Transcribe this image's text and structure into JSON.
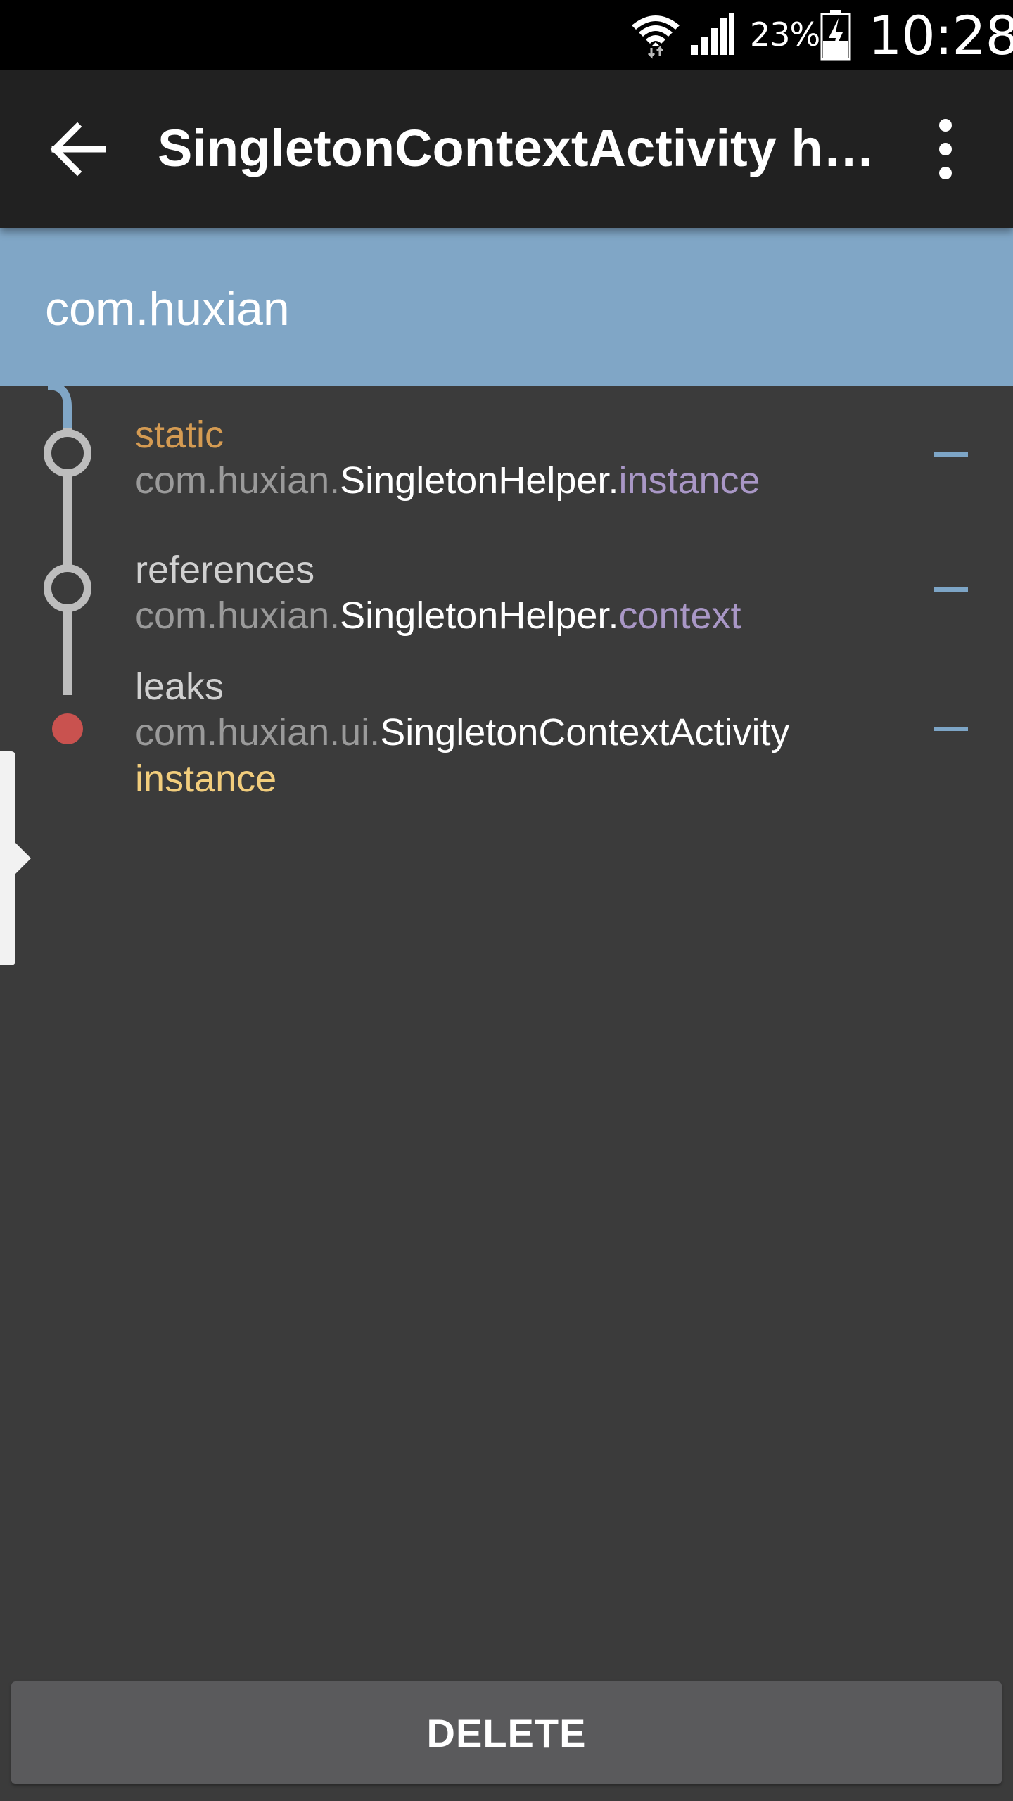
{
  "status_bar": {
    "battery_percent": "23%",
    "time": "10:28",
    "icons": [
      "wifi-icon",
      "cellular-signal-icon",
      "battery-charging-icon"
    ]
  },
  "app_bar": {
    "title": "SingletonContextActivity ha…",
    "back_icon": "arrow-back-icon",
    "menu_icon": "more-vert-icon"
  },
  "header": {
    "package": "com.huxian"
  },
  "trace": [
    {
      "kind": "static",
      "package": "com.huxian.",
      "class": "SingletonHelper",
      "separator": ".",
      "field": "instance"
    },
    {
      "kind": "references",
      "package": "com.huxian.",
      "class": "SingletonHelper",
      "separator": ".",
      "field": "context"
    },
    {
      "kind": "leaks",
      "package": "com.huxian.ui.",
      "class": "SingletonContextActivity",
      "suffix": "instance"
    }
  ],
  "footer": {
    "delete_label": "DELETE"
  },
  "colors": {
    "header_band": "#80a6c6",
    "background": "#3b3b3b",
    "app_bar": "#212121",
    "static_keyword": "#d59b52",
    "field": "#a997c6",
    "instance_suffix": "#f2cd7c",
    "leak_dot": "#c9524f"
  }
}
